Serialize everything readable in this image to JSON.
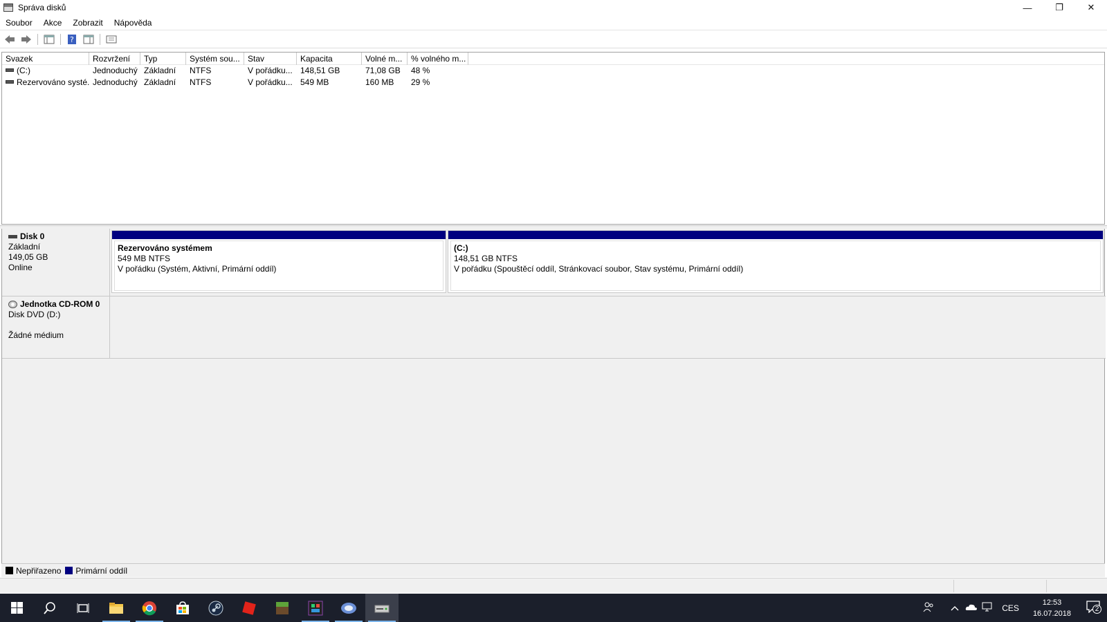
{
  "window": {
    "title": "Správa disků",
    "minimize_glyph": "—",
    "restore_glyph": "❐",
    "close_glyph": "✕"
  },
  "menu": [
    "Soubor",
    "Akce",
    "Zobrazit",
    "Nápověda"
  ],
  "toolbar": {
    "icons": [
      "back-arrow-icon",
      "forward-arrow-icon",
      "console-tree-icon",
      "help-icon",
      "action-pane-icon",
      "properties-icon"
    ]
  },
  "volume_table": {
    "columns": [
      "Svazek",
      "Rozvržení",
      "Typ",
      "Systém sou...",
      "Stav",
      "Kapacita",
      "Volné m...",
      "% volného m..."
    ],
    "rows": [
      [
        "(C:)",
        "Jednoduchý",
        "Základní",
        "NTFS",
        "V pořádku...",
        "148,51 GB",
        "71,08 GB",
        "48 %"
      ],
      [
        "Rezervováno systé...",
        "Jednoduchý",
        "Základní",
        "NTFS",
        "V pořádku...",
        "549 MB",
        "160 MB",
        "29 %"
      ]
    ]
  },
  "disks": {
    "disk0": {
      "name": "Disk 0",
      "type": "Základní",
      "size": "149,05 GB",
      "status": "Online",
      "partitions": [
        {
          "name": "Rezervováno systémem",
          "size": "549 MB NTFS",
          "status": "V pořádku (Systém, Aktivní, Primární oddíl)"
        },
        {
          "name": "(C:)",
          "size": "148,51 GB NTFS",
          "status": "V pořádku (Spouštěcí oddíl, Stránkovací soubor, Stav systému, Primární oddíl)"
        }
      ]
    },
    "cdrom0": {
      "name": "Jednotka CD-ROM 0",
      "type": "Disk DVD (D:)",
      "status": "Žádné médium"
    }
  },
  "legend": [
    {
      "label": "Nepřiřazeno",
      "color": "#000000"
    },
    {
      "label": "Primární oddíl",
      "color": "#000080"
    }
  ],
  "colors": {
    "primary_partition": "#000080",
    "unallocated": "#000000",
    "taskbar": "#1b1f2b"
  },
  "taskbar": {
    "apps": [
      "start-icon",
      "search-icon",
      "task-view-icon",
      "file-explorer-icon",
      "chrome-icon",
      "store-icon",
      "steam-icon",
      "roblox-icon",
      "minecraft-icon",
      "game-icon",
      "network-app-icon",
      "disk-management-icon"
    ],
    "language": "CES",
    "time": "12:53",
    "date": "16.07.2018",
    "notifications": "2"
  }
}
